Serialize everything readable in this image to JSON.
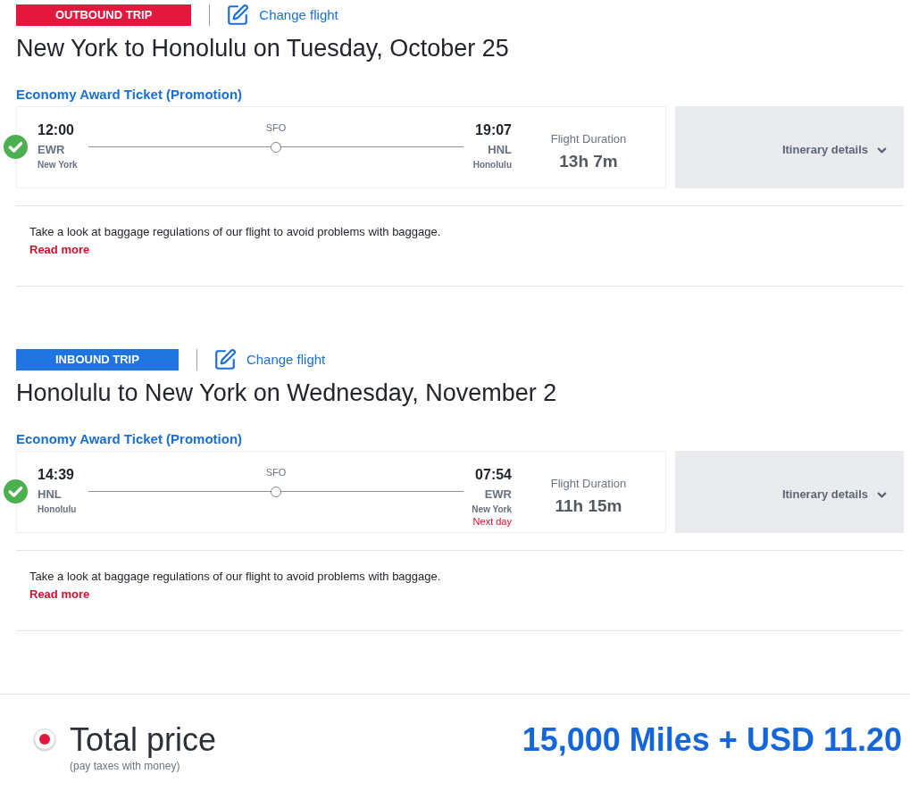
{
  "trips": [
    {
      "kind": "outbound",
      "badge": "OUTBOUND TRIP",
      "change_link": "Change flight",
      "title": "New York to Honolulu on Tuesday, October 25",
      "fare": "Economy Award Ticket (Promotion)",
      "confirmed": true,
      "flight": {
        "departure": {
          "time": "12:00",
          "code": "EWR",
          "city": "New York"
        },
        "stop": "SFO",
        "arrival": {
          "time": "19:07",
          "code": "HNL",
          "city": "Honolulu"
        },
        "duration_label": "Flight Duration",
        "duration": "13h 7m"
      },
      "details_button": "Itinerary details",
      "baggage_note": "Take a look at baggage regulations of our flight to avoid problems with baggage.",
      "read_more": "Read more"
    },
    {
      "kind": "inbound",
      "badge": "INBOUND TRIP",
      "change_link": "Change flight",
      "title": "Honolulu to New York on Wednesday, November 2",
      "fare": "Economy Award Ticket (Promotion)",
      "confirmed": true,
      "flight": {
        "departure": {
          "time": "14:39",
          "code": "HNL",
          "city": "Honolulu"
        },
        "stop": "SFO",
        "arrival": {
          "time": "07:54",
          "code": "EWR",
          "city": "New York",
          "day_note": "Next day"
        },
        "duration_label": "Flight Duration",
        "duration": "11h 15m"
      },
      "details_button": "Itinerary details",
      "baggage_note": "Take a look at baggage regulations of our flight to avoid problems with baggage.",
      "read_more": "Read more"
    }
  ],
  "total": {
    "selected": true,
    "label": "Total price",
    "note": "(pay taxes with money)",
    "price": "15,000 Miles + USD 11.20"
  }
}
